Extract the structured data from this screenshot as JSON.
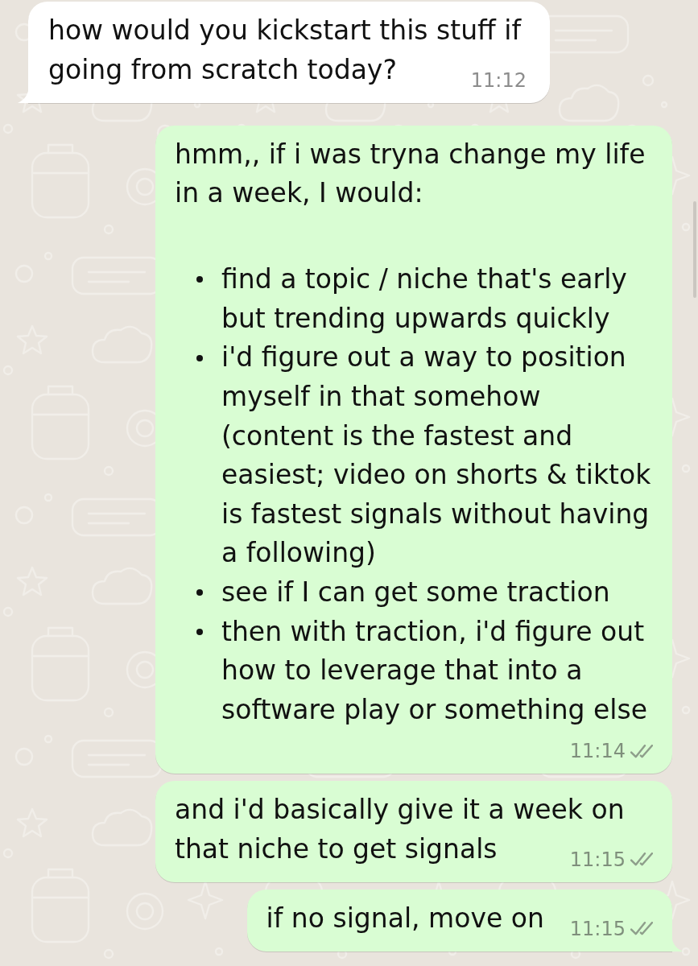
{
  "messages": [
    {
      "kind": "incoming",
      "tail": true,
      "text": "how would you kickstart this stuff if going from scratch today?",
      "time": "11:12"
    },
    {
      "kind": "outgoing",
      "tail": false,
      "text": "hmm,, if i was tryna change my life in a week, I would:",
      "bullets": [
        "find a topic / niche that's early but trending upwards quickly",
        "i'd figure out a way to position myself in that somehow (content is the fastest and easiest; video on shorts & tiktok is fastest signals without having a following)",
        "see if I can get some traction",
        "then with traction, i'd figure out how to leverage that into a software play or something else"
      ],
      "time": "11:14",
      "read": false
    },
    {
      "kind": "outgoing",
      "tail": false,
      "text": "and i'd basically give it a week on that niche to get signals",
      "time": "11:15",
      "read": false
    },
    {
      "kind": "outgoing",
      "tail": true,
      "text": "if no signal, move on",
      "time": "11:15",
      "read": false
    }
  ]
}
